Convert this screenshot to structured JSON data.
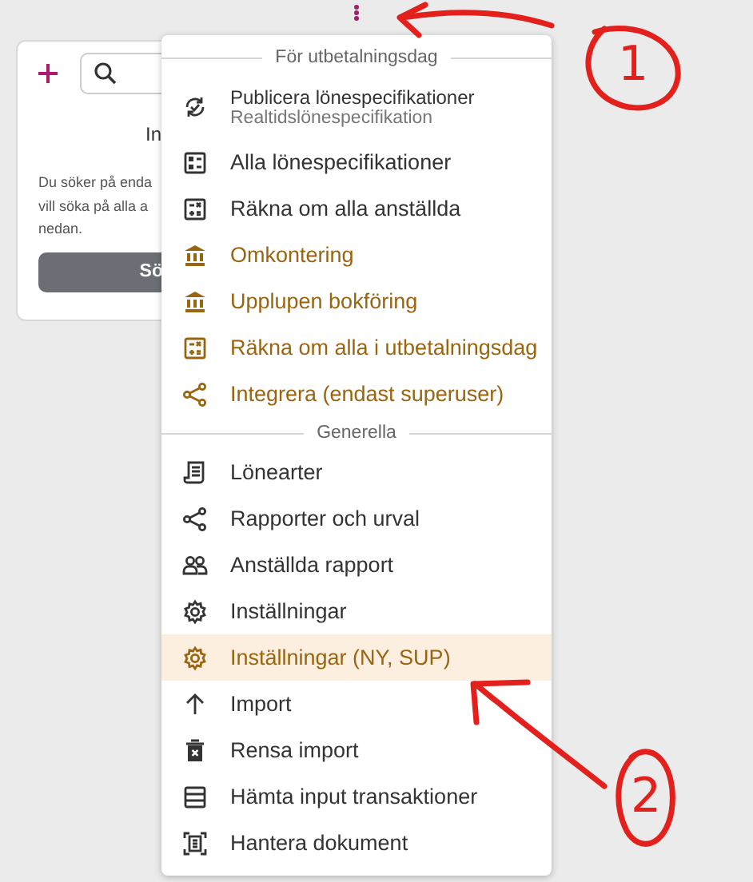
{
  "card": {
    "title": "In",
    "message_lines": [
      "Du söker på enda",
      "vill söka på alla a",
      "nedan."
    ],
    "button": "Sö"
  },
  "menu": {
    "sections": [
      {
        "heading": "För utbetalningsdag",
        "items": [
          {
            "label": "Publicera lönespecifikationer",
            "sublabel": "Realtidslönespecifikation",
            "color": "#333333",
            "selected": false
          },
          {
            "label": "Alla lönespecifikationer",
            "color": "#333333",
            "selected": false
          },
          {
            "label": "Räkna om alla anställda",
            "color": "#333333",
            "selected": false
          },
          {
            "label": "Omkontering",
            "color": "#9a6510",
            "selected": false
          },
          {
            "label": "Upplupen bokföring",
            "color": "#9a6510",
            "selected": false
          },
          {
            "label": "Räkna om alla i utbetalningsdag",
            "color": "#9a6510",
            "selected": false
          },
          {
            "label": "Integrera (endast superuser)",
            "color": "#9a6510",
            "selected": false
          }
        ]
      },
      {
        "heading": "Generella",
        "items": [
          {
            "label": "Lönearter",
            "color": "#333333",
            "selected": false
          },
          {
            "label": "Rapporter och urval",
            "color": "#333333",
            "selected": false
          },
          {
            "label": "Anställda rapport",
            "color": "#333333",
            "selected": false
          },
          {
            "label": "Inställningar",
            "color": "#333333",
            "selected": false
          },
          {
            "label": "Inställningar (NY, SUP)",
            "color": "#9a6510",
            "selected": true
          },
          {
            "label": "Import",
            "color": "#333333",
            "selected": false
          },
          {
            "label": "Rensa import",
            "color": "#333333",
            "selected": false
          },
          {
            "label": "Hämta input transaktioner",
            "color": "#333333",
            "selected": false
          },
          {
            "label": "Hantera dokument",
            "color": "#333333",
            "selected": false
          }
        ]
      }
    ]
  },
  "annotations": [
    {
      "number": "1"
    },
    {
      "number": "2"
    }
  ]
}
